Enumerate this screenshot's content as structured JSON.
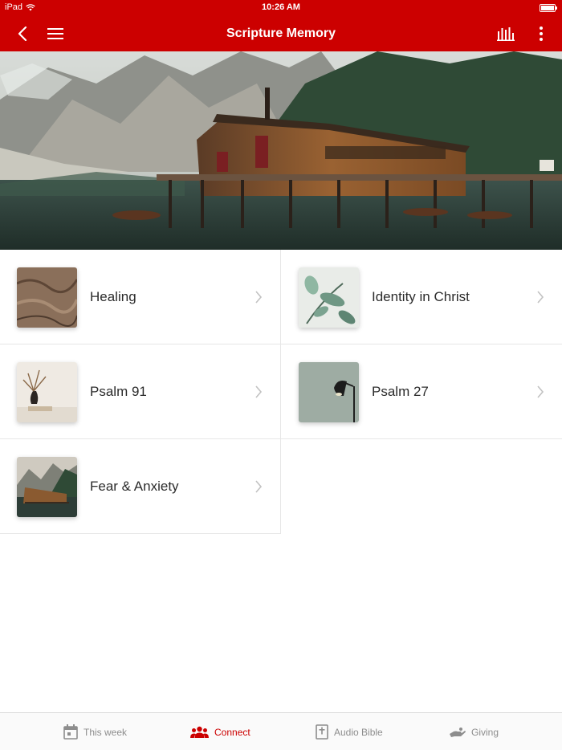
{
  "status_bar": {
    "device": "iPad",
    "time": "10:26 AM"
  },
  "nav": {
    "title": "Scripture Memory",
    "icons": [
      "back-chevron-icon",
      "hamburger-menu-icon",
      "bar-chart-icon",
      "more-vertical-icon"
    ]
  },
  "topics": [
    {
      "label": "Healing",
      "thumb": "rock-texture"
    },
    {
      "label": "Identity in Christ",
      "thumb": "plant-leaves"
    },
    {
      "label": "Psalm 91",
      "thumb": "vase-branch"
    },
    {
      "label": "Psalm 27",
      "thumb": "desk-lamp"
    },
    {
      "label": "Fear & Anxiety",
      "thumb": "lake-cabin"
    }
  ],
  "tabs": [
    {
      "label": "This week",
      "icon": "calendar-icon",
      "active": false
    },
    {
      "label": "Connect",
      "icon": "people-icon",
      "active": true
    },
    {
      "label": "Audio Bible",
      "icon": "bible-icon",
      "active": false
    },
    {
      "label": "Giving",
      "icon": "giving-hand-icon",
      "active": false
    }
  ],
  "colors": {
    "brand": "#cc0000",
    "tab_inactive": "#8d8d8d",
    "divider": "#e6e6e6"
  }
}
